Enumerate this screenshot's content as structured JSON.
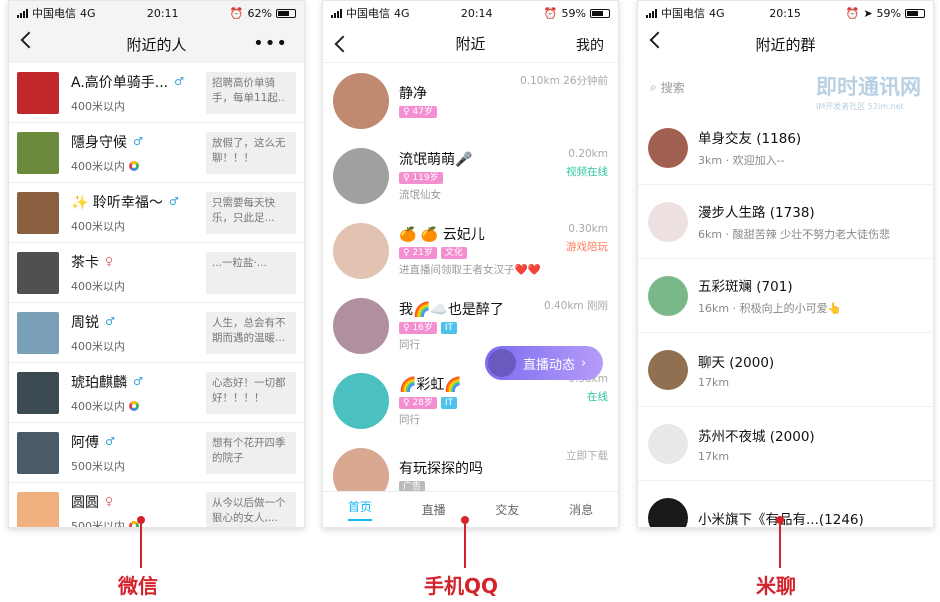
{
  "wechat": {
    "status": {
      "carrier": "中国电信",
      "network": "4G",
      "time": "20:11",
      "battery": "62%"
    },
    "title": "附近的人",
    "items": [
      {
        "name": "A.高价单骑手...",
        "gender": "m",
        "dist": "400米以内",
        "sig": "招聘高价单骑手，每单11起..",
        "color": "#c0282c",
        "moment": false
      },
      {
        "name": "隱身守候",
        "gender": "m",
        "dist": "400米以内",
        "sig": "放假了，这么无聊！！！",
        "color": "#6b8a3c",
        "moment": true
      },
      {
        "name": "✨ 聆听幸福～",
        "gender": "m",
        "dist": "400米以内",
        "sig": "只需要每天快乐，只此足...",
        "color": "#8a6040",
        "moment": false
      },
      {
        "name": "茶卡",
        "gender": "f",
        "dist": "400米以内",
        "sig": "...一粒盐·...",
        "color": "#505050",
        "moment": false
      },
      {
        "name": "周锐",
        "gender": "m",
        "dist": "400米以内",
        "sig": "人生，总会有不期而遇的温暖...",
        "color": "#7aa0b8",
        "moment": false
      },
      {
        "name": "琥珀麒麟",
        "gender": "m",
        "dist": "400米以内",
        "sig": "心态好！一切都好！！！！",
        "color": "#3c4a52",
        "moment": true
      },
      {
        "name": "阿傅",
        "gender": "m",
        "dist": "500米以内",
        "sig": "想有个花开四季的院子",
        "color": "#4a5a66",
        "moment": false
      },
      {
        "name": "圆圆",
        "gender": "f",
        "dist": "500米以内",
        "sig": "从今以后做一个狠心的女人,...",
        "color": "#f0b080",
        "moment": true
      }
    ],
    "caption": "微信"
  },
  "qq": {
    "status": {
      "carrier": "中国电信",
      "network": "4G",
      "time": "20:14",
      "battery": "59%"
    },
    "title": "附近",
    "mine": "我的",
    "items": [
      {
        "name": "静净",
        "tags": [
          {
            "t": "♀ 47岁",
            "c": "pink"
          }
        ],
        "sub": "",
        "dist": "0.10km 26分钟前",
        "st": "",
        "stc": "",
        "color": "#c08a70"
      },
      {
        "name": "流氓萌萌🎤",
        "tags": [
          {
            "t": "♀ 119岁",
            "c": "pink"
          }
        ],
        "sub": "流氓仙女",
        "dist": "0.20km",
        "st": "视频在线",
        "stc": "green",
        "color": "#a0a0a0"
      },
      {
        "name": "🍊 🍊 云妃儿",
        "tags": [
          {
            "t": "♀ 21岁",
            "c": "pink"
          },
          {
            "t": "文化",
            "c": "pink"
          }
        ],
        "sub": "进直播间领取王者女汉子❤️❤️",
        "dist": "0.30km",
        "st": "游戏陪玩",
        "stc": "orange",
        "color": "#e2c2b0"
      },
      {
        "name": "我🌈☁️也是醉了",
        "tags": [
          {
            "t": "♀ 16岁",
            "c": "pink"
          },
          {
            "t": "IT",
            "c": "blue"
          }
        ],
        "sub": "同行",
        "dist": "0.40km 刚刚",
        "st": "",
        "stc": "",
        "color": "#b090a0"
      },
      {
        "name": "🌈彩虹🌈",
        "tags": [
          {
            "t": "♀ 28岁",
            "c": "pink"
          },
          {
            "t": "IT",
            "c": "blue"
          }
        ],
        "sub": "同行",
        "dist": "0.50km",
        "st": "在线",
        "stc": "green",
        "color": "#4ac0c0"
      },
      {
        "name": "有玩探探的吗",
        "tags": [
          {
            "t": "广告",
            "c": "gray"
          }
        ],
        "sub": "",
        "dist": "立即下载",
        "st": "",
        "stc": "",
        "color": "#d8a890"
      }
    ],
    "live": "直播动态",
    "tabs": [
      "首页",
      "直播",
      "交友",
      "消息"
    ],
    "caption": "手机QQ"
  },
  "mi": {
    "status": {
      "carrier": "中国电信",
      "network": "4G",
      "time": "20:15",
      "battery": "59%"
    },
    "title": "附近的群",
    "search": "搜索",
    "watermark": "即时通讯网",
    "watermark_sub": "IM开发者社区 52im.net",
    "items": [
      {
        "name": "单身交友 (1186)",
        "sub": "3km · 欢迎加入--",
        "color": "#a06050"
      },
      {
        "name": "漫步人生路 (1738)",
        "sub": "6km · 酸甜苦辣 少壮不努力老大徒伤悲",
        "color": "#ece0e0"
      },
      {
        "name": "五彩斑斓 (701)",
        "sub": "16km · 积极向上的小可爱👆",
        "color": "#7ab88a"
      },
      {
        "name": "聊天 (2000)",
        "sub": "17km",
        "color": "#907050"
      },
      {
        "name": "苏州不夜城 (2000)",
        "sub": "17km",
        "color": "#e8e8e8"
      },
      {
        "name": "小米旗下《有品有...(1246)",
        "sub": "",
        "color": "#1a1a1a"
      }
    ],
    "caption": "米聊"
  }
}
